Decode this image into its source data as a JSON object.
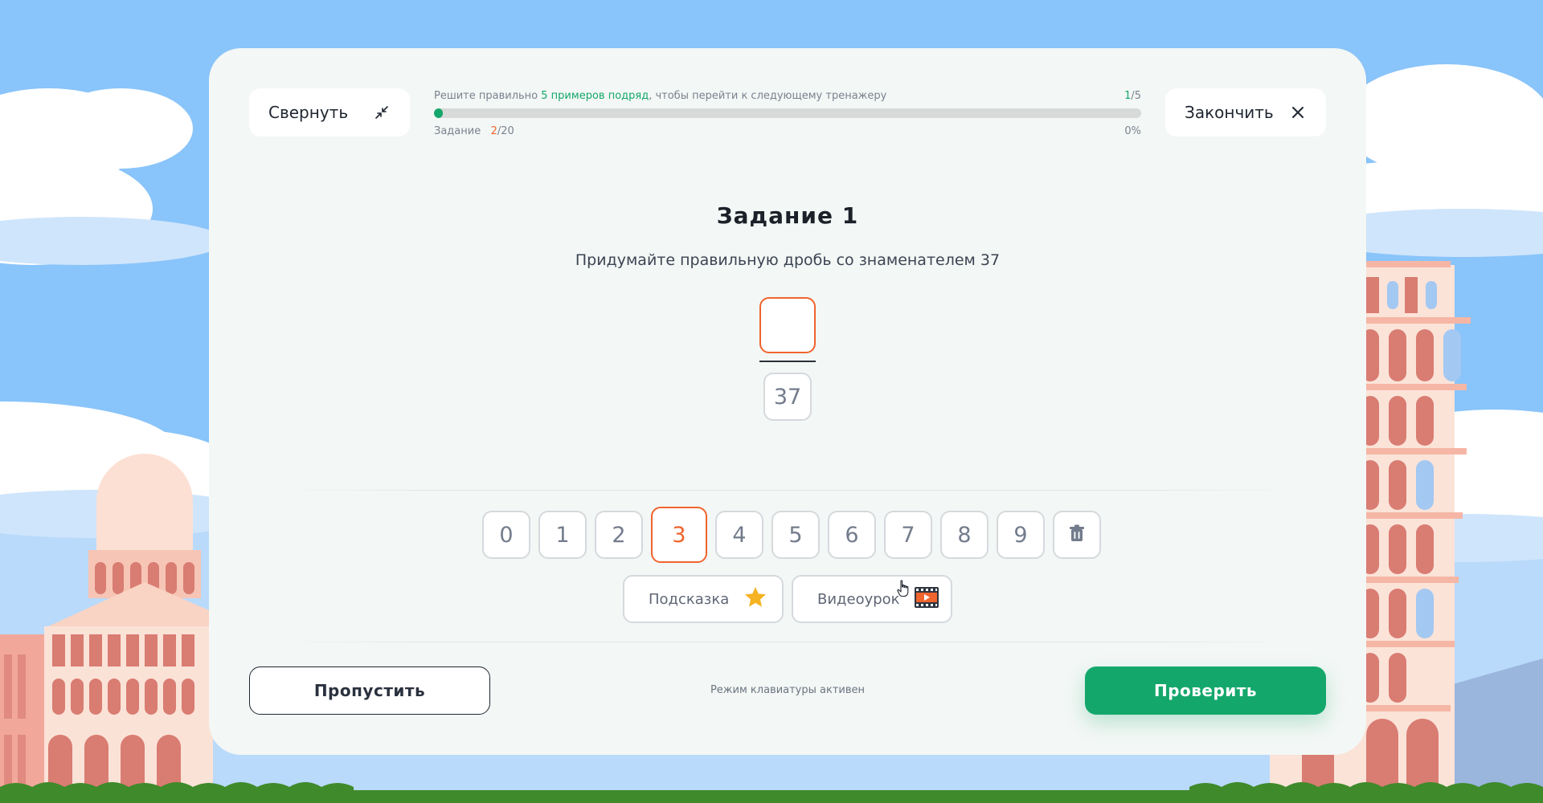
{
  "header": {
    "collapse_label": "Свернуть",
    "finish_label": "Закончить",
    "progress": {
      "instruction_prefix": "Решите правильно ",
      "instruction_highlight": "5 примеров подряд",
      "instruction_suffix": ", чтобы перейти к следующему тренажеру",
      "streak_current": "1",
      "streak_total": "/5",
      "task_label": "Задание",
      "task_current": "2",
      "task_total": "/20",
      "percent_label": "0%",
      "fill_fraction": 0.0
    }
  },
  "task": {
    "title": "Задание 1",
    "text": "Придумайте правильную дробь со знаменателем 37",
    "numerator": "",
    "denominator": "37"
  },
  "keypad": {
    "keys": [
      "0",
      "1",
      "2",
      "3",
      "4",
      "5",
      "6",
      "7",
      "8",
      "9"
    ],
    "active_key": "3",
    "delete_icon": "trash-icon"
  },
  "helpers": {
    "hint_label": "Подсказка",
    "hint_icon": "star-icon",
    "video_label": "Видеоурок",
    "video_icon": "film-play-icon"
  },
  "footer": {
    "skip_label": "Пропустить",
    "keyboard_mode": "Режим клавиатуры активен",
    "check_label": "Проверить"
  },
  "colors": {
    "accent_green": "#14a76c",
    "accent_orange": "#f0642d",
    "sky": "#89c4fa",
    "card": "#f3f7f5"
  }
}
